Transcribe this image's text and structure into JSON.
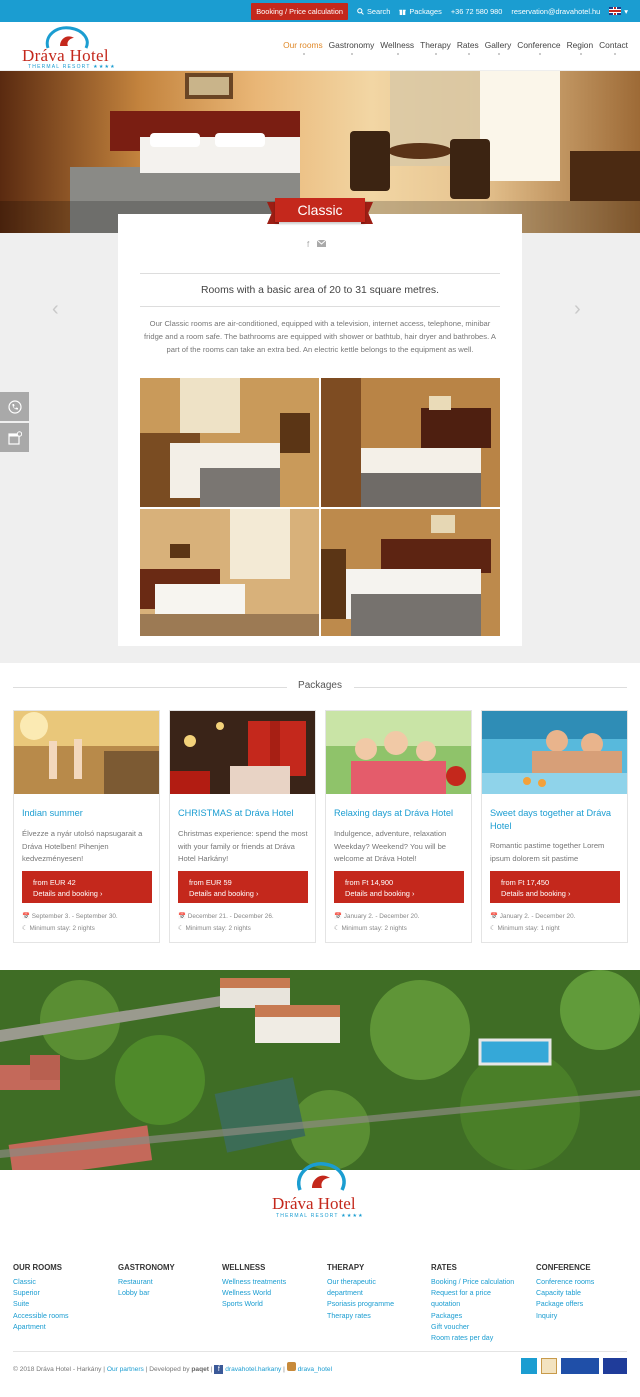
{
  "topbar": {
    "booking_label": "Booking / Price calculation",
    "search_label": "Search",
    "packages_label": "Packages",
    "phone": "+36 72 580 980",
    "email": "reservation@dravahotel.hu",
    "language": "EN"
  },
  "brand": {
    "name": "Dráva Hotel",
    "tagline": "THERMAL RESORT ★★★★"
  },
  "nav": {
    "items": [
      "Our rooms",
      "Gastronomy",
      "Wellness",
      "Therapy",
      "Rates",
      "Gallery",
      "Conference",
      "Region",
      "Contact"
    ],
    "active": "Our rooms"
  },
  "room": {
    "title": "Classic",
    "lead": "Rooms with a basic area of 20 to 31 square metres.",
    "description": "Our Classic rooms are air-conditioned, equipped with a television, internet access, telephone, minibar fridge and a room safe. The bathrooms are equipped with shower or bathtub, hair dryer and bathrobes. A part of the rooms can take an extra bed. An electric kettle belongs to the equipment as well."
  },
  "packages": {
    "section_title": "Packages",
    "items": [
      {
        "title": "Indian summer",
        "text": "Élvezze a nyár utolsó napsugarait a Dráva Hotelben! Pihenjen kedvezményesen!",
        "price": "from EUR 42",
        "cta": "Details and booking ›",
        "dates": "September 3. - September 30.",
        "stay": "Minimum stay: 2 nights"
      },
      {
        "title": "CHRISTMAS at Dráva Hotel",
        "text": "Christmas experience: spend the most with your family or friends at Dráva Hotel Harkány!",
        "price": "from EUR 59",
        "cta": "Details and booking ›",
        "dates": "December 21. - December 26.",
        "stay": "Minimum stay: 2 nights"
      },
      {
        "title": "Relaxing days at Dráva Hotel",
        "text": "Indulgence, adventure, relaxation Weekday? Weekend? You will be welcome at Dráva Hotel!",
        "price": "from Ft 14,900",
        "cta": "Details and booking ›",
        "dates": "January 2. - December 20.",
        "stay": "Minimum stay: 2 nights"
      },
      {
        "title": "Sweet days together at Dráva Hotel",
        "text": "Romantic pastime together Lorem ipsum dolorem sit pastime",
        "price": "from Ft 17,450",
        "cta": "Details and booking ›",
        "dates": "January 2. - December 20.",
        "stay": "Minimum stay: 1 night"
      }
    ]
  },
  "footer": {
    "columns": [
      {
        "heading": "OUR ROOMS",
        "links": [
          "Classic",
          "Superior",
          "Suite",
          "Accessible rooms",
          "Apartment"
        ]
      },
      {
        "heading": "GASTRONOMY",
        "links": [
          "Restaurant",
          "Lobby bar"
        ]
      },
      {
        "heading": "WELLNESS",
        "links": [
          "Wellness treatments",
          "Wellness World",
          "Sports World"
        ]
      },
      {
        "heading": "THERAPY",
        "links": [
          "Our therapeutic",
          "department",
          "Psoriasis programme",
          "Therapy rates"
        ]
      },
      {
        "heading": "RATES",
        "links": [
          "Booking / Price calculation",
          "Request for a price",
          "quotation",
          "Packages",
          "Gift voucher",
          "Room rates per day"
        ]
      },
      {
        "heading": "CONFERENCE",
        "links": [
          "Conference rooms",
          "Capacity table",
          "Package offers",
          "Inquiry"
        ]
      }
    ],
    "copyright": "© 2018 Dráva Hotel - Harkány |",
    "partners": "Our partners",
    "developed_by": "| Developed by",
    "developer": "paqet",
    "facebook": "dravahotel.harkany",
    "instagram": "drava_hotel"
  },
  "colors": {
    "accent": "#1b9dd1",
    "brand_red": "#c4281c",
    "active_nav": "#e08a2b"
  }
}
